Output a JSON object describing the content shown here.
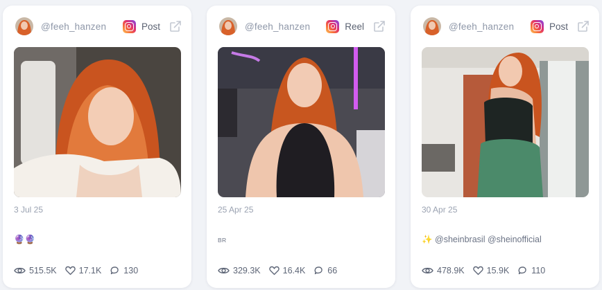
{
  "cards": [
    {
      "username": "@feeh_hanzen",
      "platform_icon": "instagram-icon",
      "post_type": "Post",
      "date": "3 Jul 25",
      "caption": "🔮🔮",
      "views": "515.5K",
      "likes": "17.1K",
      "comments": "130"
    },
    {
      "username": "@feeh_hanzen",
      "platform_icon": "instagram-icon",
      "post_type": "Reel",
      "date": "25 Apr 25",
      "caption": "BR",
      "views": "329.3K",
      "likes": "16.4K",
      "comments": "66"
    },
    {
      "username": "@feeh_hanzen",
      "platform_icon": "instagram-icon",
      "post_type": "Post",
      "date": "30 Apr 25",
      "caption": "✨ @sheinbrasil @sheinofficial",
      "views": "478.9K",
      "likes": "15.9K",
      "comments": "110"
    }
  ],
  "colors": {
    "card_background": "#ffffff",
    "page_background": "#f1f3f7",
    "muted_text": "#8e97a8",
    "hair": "#d8612a"
  }
}
